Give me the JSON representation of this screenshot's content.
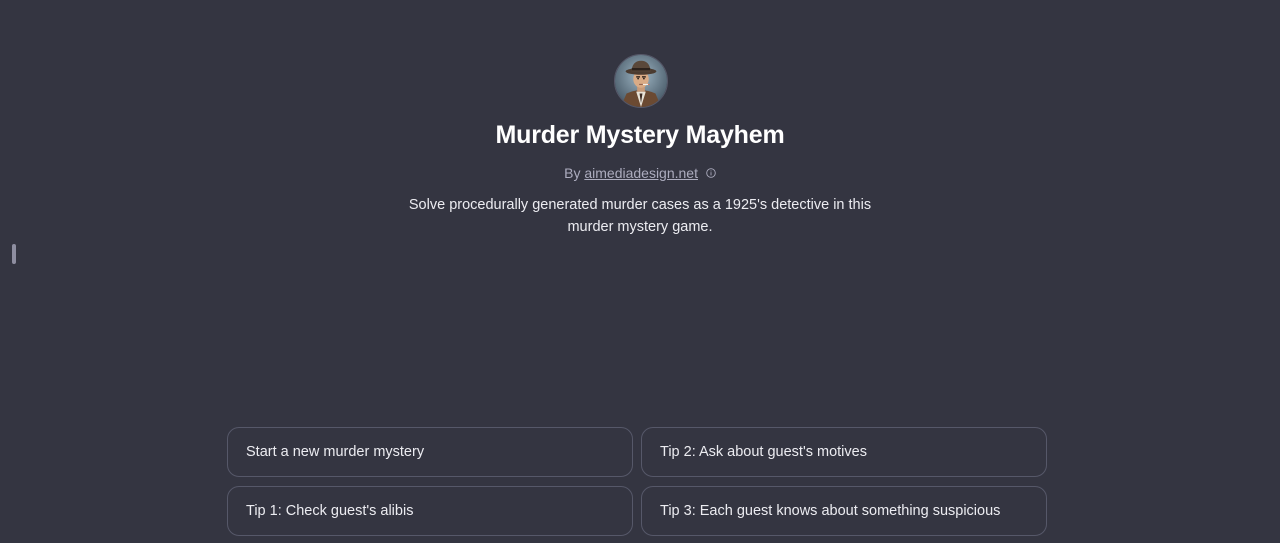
{
  "gpt": {
    "avatar_icon": "detective-avatar",
    "title": "Murder Mystery Mayhem",
    "by_prefix": "By",
    "author": "aimediadesign.net",
    "info_icon": "info-icon",
    "description": "Solve procedurally generated murder cases as a 1925's detective in this murder mystery game."
  },
  "conversation_starters": [
    "Start a new murder mystery",
    "Tip 2: Ask about guest's motives",
    "Tip 1: Check guest's alibis",
    "Tip 3: Each guest knows about something suspicious"
  ],
  "colors": {
    "background": "#343541",
    "text_primary": "#ececf1",
    "text_muted": "#acacbe",
    "border": "#565869"
  }
}
